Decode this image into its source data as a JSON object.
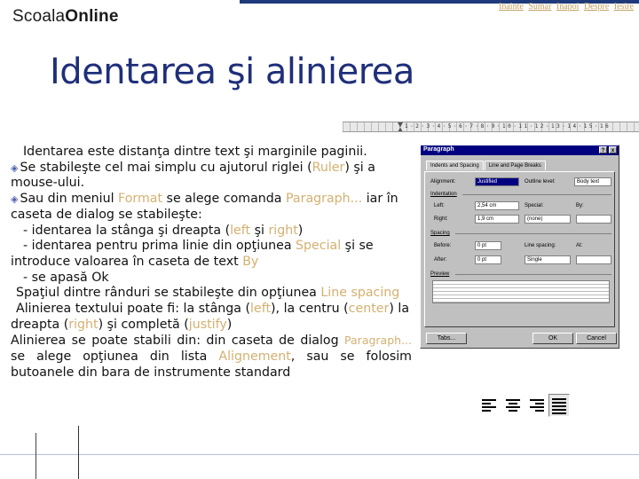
{
  "header": {
    "logo_prefix": "Scoala",
    "logo_suffix": "Online",
    "nav": [
      "Inainte",
      "Sumar",
      "Inapoi",
      "Despre",
      "Iesire"
    ]
  },
  "title": "Identarea şi alinierea",
  "content": {
    "l1_a": "Identarea",
    "l1_b": " este distanţa dintre text şi marginile paginii.",
    "l2_a": "Se stabileşte cel mai simplu cu ajutorul riglei (",
    "l2_hl": "Ruler",
    "l2_b": ") şi a mouse-ului.",
    "l3_a": "Sau din meniul ",
    "l3_hl1": "Format",
    "l3_b": " se alege comanda ",
    "l3_hl2": "Paragraph...",
    "l3_c": " iar în caseta de dialog se stabileşte:",
    "l4_a": "- identarea la stânga şi dreapta (",
    "l4_hl1": "left",
    "l4_b": " şi ",
    "l4_hl2": "right",
    "l4_c": ")",
    "l5_a": "- identarea pentru prima linie din opţiunea ",
    "l5_hl": "Special",
    "l5_b": " şi se introduce valoarea în caseta de text ",
    "l5_hl2": "By",
    "l6": "- se apasă Ok",
    "l7_a": "Spaţiul",
    "l7_b": " dintre rânduri se stabileşte din opţiunea ",
    "l7_hl": "Line spacing",
    "l8_a": "Alinierea",
    "l8_b": " textului poate fi:  la stânga (",
    "l8_hl1": "left",
    "l8_c": "),  la centru (",
    "l8_hl2": "center",
    "l8_d": ") la dreapta (",
    "l8_hl3": "right",
    "l8_e": ") şi completă (",
    "l8_hl4": "justify",
    "l8_f": ")",
    "l9_a": "Alinierea se poate stabili din: din caseta de dialog ",
    "l9_hl1": "Paragraph...",
    "l9_b": "  se alege opţiunea din lista ",
    "l9_hl2": "Alignement",
    "l9_c": ", sau se folosim butoanele din bara de instrumente standard"
  },
  "dialog": {
    "title": "Paragraph",
    "help": "?",
    "close": "x",
    "tab1": "Indents and Spacing",
    "tab2": "Line and Page Breaks",
    "alignment_label": "Alignment:",
    "alignment_value": "Justified",
    "outline_label": "Outline level:",
    "outline_value": "Body text",
    "indentation_label": "Indentation",
    "left_label": "Left:",
    "left_value": "2,54 cm",
    "right_label": "Right:",
    "right_value": "1,9 cm",
    "special_label": "Special:",
    "special_value": "(none)",
    "by_label": "By:",
    "spacing_label": "Spacing",
    "before_label": "Before:",
    "before_value": "0 pt",
    "after_label": "After:",
    "after_value": "0 pt",
    "line_spacing_label": "Line spacing:",
    "line_spacing_value": "Single",
    "at_label": "At:",
    "preview_label": "Preview",
    "tabs_button": "Tabs...",
    "ok_button": "OK",
    "cancel_button": "Cancel"
  },
  "toolbar": {
    "icons": [
      "align-left-icon",
      "align-center-icon",
      "align-right-icon",
      "justify-icon"
    ]
  }
}
